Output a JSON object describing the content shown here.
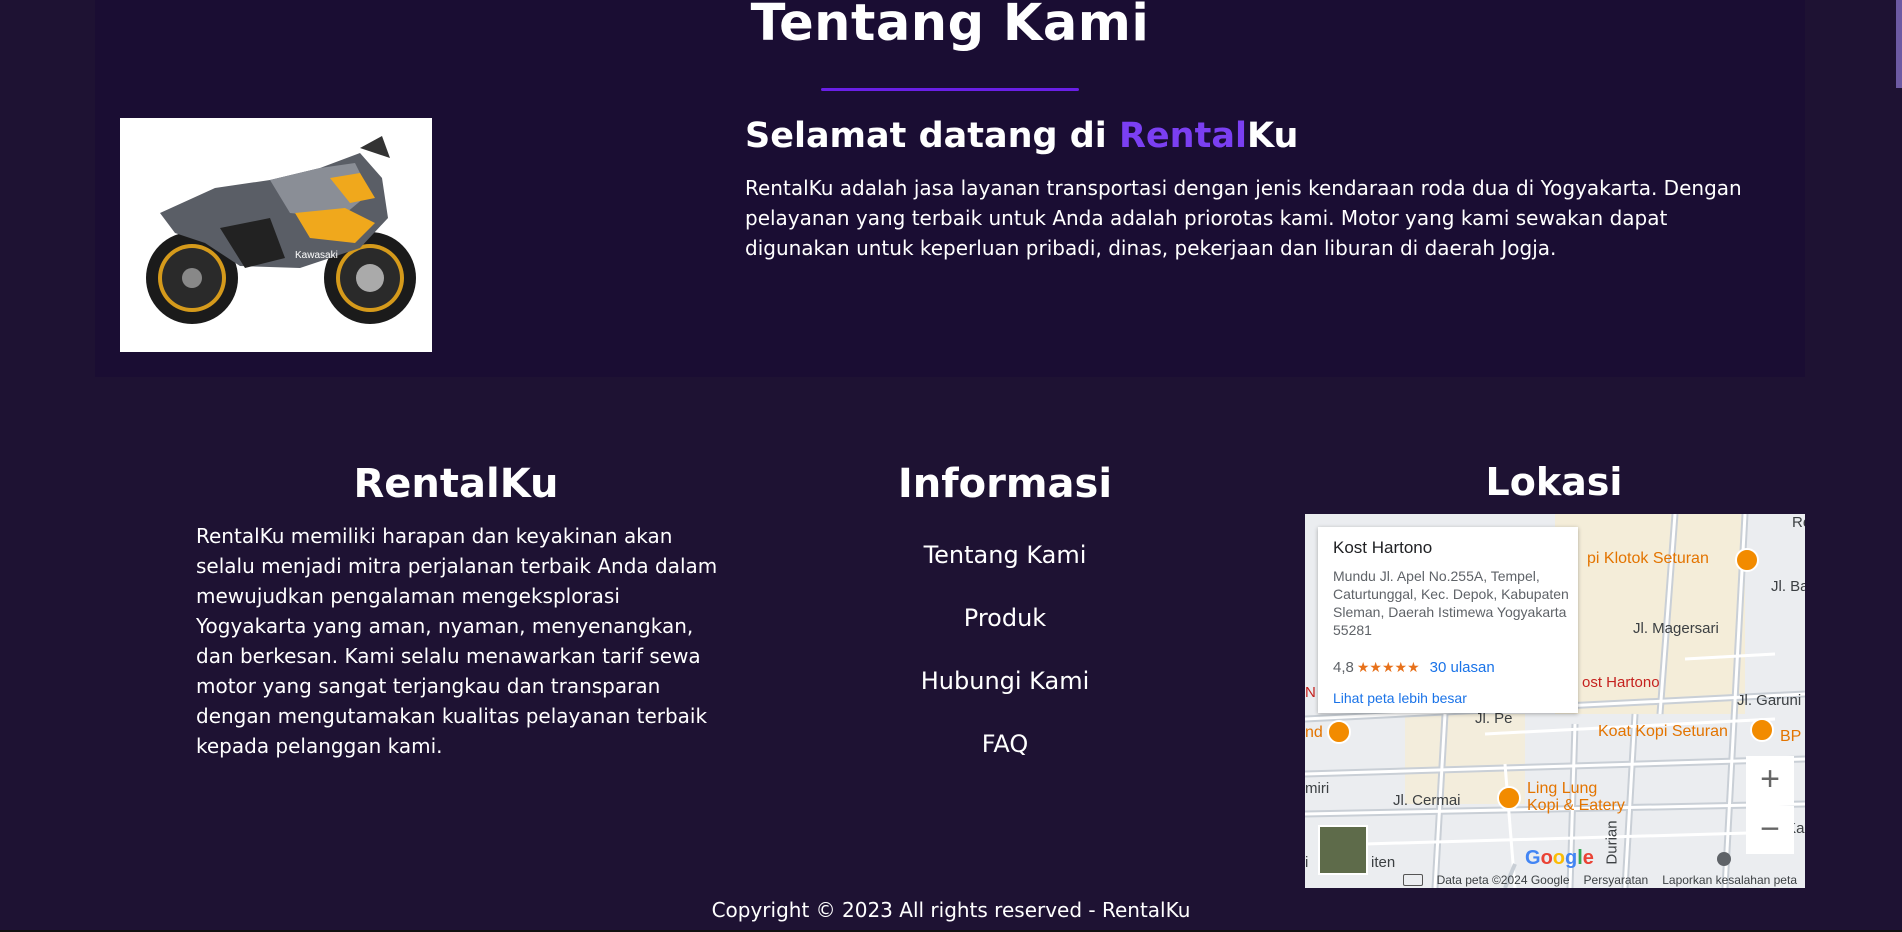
{
  "about": {
    "title": "Tentang Kami",
    "heading_prefix": "Selamat datang di ",
    "heading_accent": "Rental",
    "heading_suffix": "Ku",
    "description": "RentalKu adalah jasa layanan transportasi dengan jenis kendaraan roda dua di Yogyakarta. Dengan pelayanan yang terbaik untuk Anda adalah priorotas kami. Motor yang kami sewakan dapat digunakan untuk keperluan pribadi, dinas, pekerjaan dan liburan di daerah Jogja.",
    "image_alt": "Kawasaki"
  },
  "footer": {
    "brand_title": "RentalKu",
    "brand_text": "RentalKu memiliki harapan dan keyakinan akan selalu menjadi mitra perjalanan terbaik Anda dalam mewujudkan pengalaman mengeksplorasi Yogyakarta yang aman, nyaman, menyenangkan, dan berkesan. Kami selalu menawarkan tarif sewa motor yang sangat terjangkau dan transparan dengan mengutamakan kualitas pelayanan terbaik kepada pelanggan kami.",
    "info_title": "Informasi",
    "info_links": [
      "Tentang Kami",
      "Produk",
      "Hubungi Kami",
      "FAQ"
    ],
    "location_title": "Lokasi",
    "copyright": "Copyright © 2023 All rights reserved - RentalKu"
  },
  "map": {
    "place_name": "Kost Hartono",
    "address": "Mundu Jl. Apel No.255A, Tempel, Caturtunggal, Kec. Depok, Kabupaten Sleman, Daerah Istimewa Yogyakarta 55281",
    "rating": "4,8",
    "stars": "★★★★★",
    "reviews": "30 ulasan",
    "larger_map": "Lihat peta lebih besar",
    "zoom_in": "+",
    "zoom_out": "−",
    "footer_data": "Data peta ©2024 Google",
    "footer_terms": "Persyaratan",
    "footer_report": "Laporkan kesalahan peta",
    "google_logo": "Google",
    "labels": {
      "klotok": "pi Klotok Seturan",
      "jl_ba": "Jl. Ba",
      "magersari": "Jl. Magersari",
      "kost_hartono": "ost Hartono",
      "garuni": "Jl. Garuni",
      "koat_kopi": "Koat Kopi Seturan",
      "ling_lung_1": "Ling Lung",
      "ling_lung_2": "Kopi & Eatery",
      "cermai": "Jl. Cermai",
      "durian": "Durian",
      "pe": "Jl. Pe",
      "miri": "miri",
      "nd": "nd",
      "re": "Re",
      "ka": "Jl. Ka",
      "bp": "BP",
      "n_left": "N",
      "iten": "iten",
      "i_left": "i"
    }
  }
}
